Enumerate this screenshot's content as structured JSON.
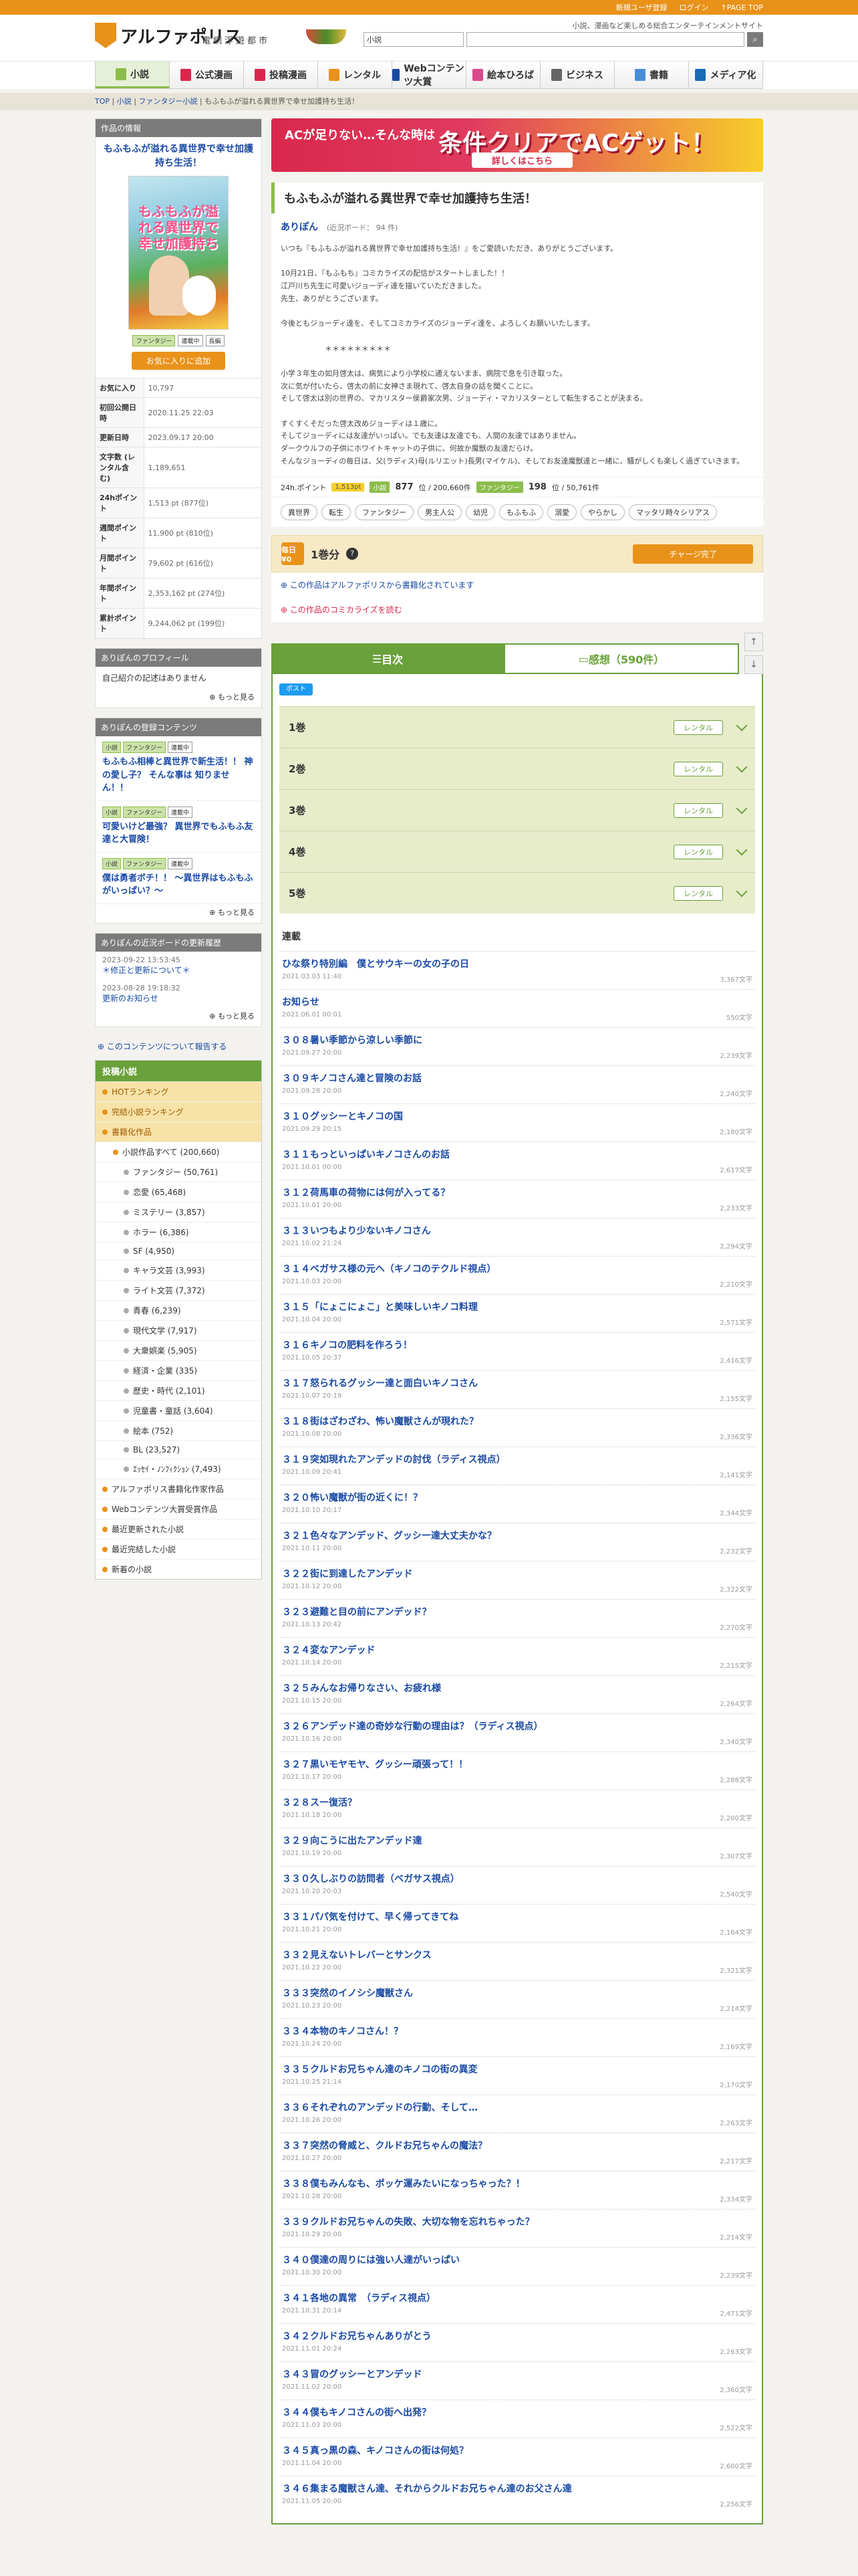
{
  "topbar": {
    "links": [
      "新規ユーザ登録",
      "ログイン",
      "↑PAGE TOP"
    ]
  },
  "header": {
    "logo_text": "アルファポリス",
    "logo_sub": "電網浮遊都市",
    "tagline": "小説、漫画など楽しめる総合エンターテインメントサイト",
    "search_select": "小説",
    "search_placeholder": ""
  },
  "nav": [
    {
      "label": "小説",
      "color": "#8bbd4c"
    },
    {
      "label": "公式漫画",
      "color": "#d9284b"
    },
    {
      "label": "投稿漫画",
      "color": "#d9284b"
    },
    {
      "label": "レンタル",
      "color": "#e9921a"
    },
    {
      "label": "Webコンテンツ大賞",
      "color": "#1a4aa5"
    },
    {
      "label": "絵本ひろば",
      "color": "#d94a8a"
    },
    {
      "label": "ビジネス",
      "color": "#666666"
    },
    {
      "label": "書籍",
      "color": "#4a8cd9"
    },
    {
      "label": "メディア化",
      "color": "#1a6ab5"
    }
  ],
  "breadcrumb": [
    "TOP",
    "小説",
    "ファンタジー小説",
    "もふもふが溢れる異世界で幸せ加護持ち生活！"
  ],
  "sidebar": {
    "info_title": "作品の情報",
    "book_title": "もふもふが溢れる異世界で幸せ加護持ち生活！",
    "cover_title": "もふもふが溢れる異世界で幸せ加護持ち",
    "mini_tags": [
      "ファンタジー",
      "連載中",
      "長編"
    ],
    "fav_btn": "お気に入りに追加",
    "stats": [
      {
        "k": "お気に入り",
        "v": "10,797"
      },
      {
        "k": "初回公開日時",
        "v": "2020.11.25 22:03"
      },
      {
        "k": "更新日時",
        "v": "2023.09.17 20:00"
      },
      {
        "k": "文字数 (レンタル含む)",
        "v": "1,189,651"
      },
      {
        "k": "24hポイント",
        "v": "1,513 pt (877位)"
      },
      {
        "k": "週間ポイント",
        "v": "11,900 pt (810位)"
      },
      {
        "k": "月間ポイント",
        "v": "79,602 pt (616位)"
      },
      {
        "k": "年間ポイント",
        "v": "2,353,162 pt (274位)"
      },
      {
        "k": "累計ポイント",
        "v": "9,244,062 pt (199位)"
      }
    ],
    "profile_title": "ありぽんのプロフィール",
    "profile_body": "自己紹介の記述はありません",
    "more": "もっと見る",
    "contents_title": "ありぽんの登録コンテンツ",
    "contents": [
      {
        "tags": [
          "小説",
          "ファンタジー",
          "連載中"
        ],
        "title": "もふもふ相棒と異世界で新生活！！ 神の愛し子？ そんな事は 知りません！！"
      },
      {
        "tags": [
          "小説",
          "ファンタジー",
          "連載中"
        ],
        "title": "可愛いけど最強？ 異世界でもふもふ友達と大冒険！"
      },
      {
        "tags": [
          "小説",
          "ファンタジー",
          "連載中"
        ],
        "title": "僕は勇者ボチ！！ 〜異世界はもふもふがいっぱい？〜"
      }
    ],
    "history_title": "ありぽんの近況ボードの更新履歴",
    "history": [
      {
        "date": "2023-09-22 13:53:45",
        "t": "＊修正と更新について＊"
      },
      {
        "date": "2023-08-28 19:18:32",
        "t": "更新のお知らせ"
      }
    ],
    "report": "このコンテンツについて報告する",
    "cat_head": "投稿小説",
    "cats": [
      {
        "label": "HOTランキング",
        "cls": "hl"
      },
      {
        "label": "完結小説ランキング",
        "cls": "hl"
      },
      {
        "label": "書籍化作品",
        "cls": "hl"
      },
      {
        "label": "小説作品すべて (200,660)",
        "cls": "sub"
      },
      {
        "label": "ファンタジー (50,761)",
        "cls": "subsub"
      },
      {
        "label": "恋愛 (65,468)",
        "cls": "subsub"
      },
      {
        "label": "ミステリー (3,857)",
        "cls": "subsub"
      },
      {
        "label": "ホラー (6,386)",
        "cls": "subsub"
      },
      {
        "label": "SF (4,950)",
        "cls": "subsub"
      },
      {
        "label": "キャラ文芸 (3,993)",
        "cls": "subsub"
      },
      {
        "label": "ライト文芸 (7,372)",
        "cls": "subsub"
      },
      {
        "label": "青春 (6,239)",
        "cls": "subsub"
      },
      {
        "label": "現代文学 (7,917)",
        "cls": "subsub"
      },
      {
        "label": "大衆娯楽 (5,905)",
        "cls": "subsub"
      },
      {
        "label": "経済・企業 (335)",
        "cls": "subsub"
      },
      {
        "label": "歴史・時代 (2,101)",
        "cls": "subsub"
      },
      {
        "label": "児童書・童話 (3,604)",
        "cls": "subsub"
      },
      {
        "label": "絵本 (752)",
        "cls": "subsub"
      },
      {
        "label": "BL (23,527)",
        "cls": "subsub"
      },
      {
        "label": "ｴｯｾｲ・ﾉﾝﾌｨｸｼｮﾝ (7,493)",
        "cls": "subsub"
      },
      {
        "label": "アルファポリス書籍化作家作品",
        "cls": ""
      },
      {
        "label": "Webコンテンツ大賞受賞作品",
        "cls": ""
      },
      {
        "label": "最近更新された小説",
        "cls": ""
      },
      {
        "label": "最近完結した小説",
        "cls": ""
      },
      {
        "label": "新着の小説",
        "cls": ""
      }
    ]
  },
  "banner": {
    "left": "ACが足りない…そんな時は",
    "big": "条件クリアでACゲット！",
    "btn": "詳しくはこちら"
  },
  "novel": {
    "title": "もふもふが溢れる異世界で幸せ加護持ち生活！",
    "author": "ありぽん",
    "board": "(近況ボード： 94 件)",
    "abstract": "いつも『もふもふが溢れる異世界で幸せ加護持ち生活！』をご愛読いただき、ありがとうございます。\n\n10月21日、『もふもち』コミカライズの配信がスタートしました！！\n江戸川ち先生に可愛いジョーディ達を描いていただきました。\n先生、ありがとうございます。\n\n今後ともジョーディ達を、そしてコミカライズのジョーディ達を、よろしくお願いいたします。\n\n　　　　　　＊＊＊＊＊＊＊＊＊\n\n小学３年生の如月啓太は、病気により小学校に通えないまま、病院で息を引き取った。\n次に気が付いたら、啓太の前に女神さま現れて、啓太自身の話を聞くことに。\nそして啓太は別の世界の、マカリスター侯爵家次男、ジョーディ・マカリスターとして転生することが決まる。\n\nすくすくそだった啓太改めジョーディは１歳に。\nそしてジョーディには友達がいっぱい。でも友達は友達でも、人間の友達ではありません。\nダークウルフの子供にホワイトキャットの子供に、何故か魔獣の友達だらけ。\nそんなジョーディの毎日は、父(ラディス)母(ルリエット)長男(マイケル)、そしてお友達魔獣達と一緒に、騒がしくも楽しく過ぎていきます。",
    "points_label": "24h.ポイント",
    "points_badge": "1,513pt",
    "rank_label1": "小説",
    "rank1": "877",
    "rank1_suffix": "位 / 200,660件",
    "rank_label2": "ファンタジー",
    "rank2": "198",
    "rank2_suffix": "位 / 50,761件",
    "tags": [
      "異世界",
      "転生",
      "ファンタジー",
      "男主人公",
      "幼児",
      "もふもふ",
      "溺愛",
      "やらかし",
      "マッタリ時々シリアス"
    ],
    "charge_icon": "毎日¥0",
    "charge_label": "1巻分",
    "charge_btn": "チャージ完了",
    "note1": "この作品はアルファポリスから書籍化されています",
    "note2": "この作品のコミカライズを読む"
  },
  "tabs": {
    "toc": "目次",
    "review": "感想（590件）"
  },
  "toc": {
    "twitter": "ポスト",
    "rental_label": "レンタル",
    "volumes": [
      "1巻",
      "2巻",
      "3巻",
      "4巻",
      "5巻"
    ],
    "section": "連載",
    "episodes": [
      {
        "t": "ひな祭り特別編　僕とサウキーの女の子の日",
        "d": "2021.03.03 11:40",
        "c": "3,367文字"
      },
      {
        "t": "お知らせ",
        "d": "2021.06.01 00:01",
        "c": "550文字"
      },
      {
        "t": "３０８暑い季節から涼しい季節に",
        "d": "2021.09.27 20:00",
        "c": "2,239文字"
      },
      {
        "t": "３０９キノコさん達と冒険のお話",
        "d": "2021.09.28 20:00",
        "c": "2,240文字"
      },
      {
        "t": "３１０グッシーとキノコの国",
        "d": "2021.09.29 20:15",
        "c": "2,180文字"
      },
      {
        "t": "３１１もっといっぱいキノコさんのお話",
        "d": "2021.10.01 00:00",
        "c": "2,617文字"
      },
      {
        "t": "３１２荷馬車の荷物には何が入ってる？",
        "d": "2021.10.01 20:00",
        "c": "2,233文字"
      },
      {
        "t": "３１３いつもより少ないキノコさん",
        "d": "2021.10.02 21:24",
        "c": "2,294文字"
      },
      {
        "t": "３１４ベガサス様の元へ（キノコのテクルド視点）",
        "d": "2021.10.03 20:00",
        "c": "2,210文字"
      },
      {
        "t": "３１５「にょこにょこ」と美味しいキノコ料理",
        "d": "2021.10.04 20:00",
        "c": "2,571文字"
      },
      {
        "t": "３１６キノコの肥料を作ろう！",
        "d": "2021.10.05 20:37",
        "c": "2,416文字"
      },
      {
        "t": "３１７怒られるグッシー達と面白いキノコさん",
        "d": "2021.10.07 20:19",
        "c": "2,155文字"
      },
      {
        "t": "３１８街はざわざわ、怖い魔獣さんが現れた？",
        "d": "2021.10.08 20:00",
        "c": "2,336文字"
      },
      {
        "t": "３１９突如現れたアンデッドの討伐（ラディス視点）",
        "d": "2021.10.09 20:41",
        "c": "2,141文字"
      },
      {
        "t": "３２０怖い魔獣が街の近くに！？",
        "d": "2021.10.10 20:17",
        "c": "2,344文字"
      },
      {
        "t": "３２１色々なアンデッド、グッシー達大丈夫かな？",
        "d": "2021.10.11 20:00",
        "c": "2,232文字"
      },
      {
        "t": "３２２街に到達したアンデッド",
        "d": "2021.10.12 20:00",
        "c": "2,322文字"
      },
      {
        "t": "３２３避難と目の前にアンデッド？",
        "d": "2021.10.13 20:42",
        "c": "2,270文字"
      },
      {
        "t": "３２４変なアンデッド",
        "d": "2021.10.14 20:00",
        "c": "2,215文字"
      },
      {
        "t": "３２５みんなお帰りなさい、お疲れ様",
        "d": "2021.10.15 20:00",
        "c": "2,264文字"
      },
      {
        "t": "３２６アンデッド達の奇妙な行動の理由は？（ラディス視点）",
        "d": "2021.10.16 20:00",
        "c": "2,340文字"
      },
      {
        "t": "３２７黒いモヤモヤ、グッシー頑張って！！",
        "d": "2021.10.17 20:00",
        "c": "2,288文字"
      },
      {
        "t": "３２８スー復活？",
        "d": "2021.10.18 20:00",
        "c": "2,200文字"
      },
      {
        "t": "３２９向こうに出たアンデッド達",
        "d": "2021.10.19 20:00",
        "c": "2,307文字"
      },
      {
        "t": "３３０久しぶりの訪問者（ベガサス視点）",
        "d": "2021.10.20 20:03",
        "c": "2,540文字"
      },
      {
        "t": "３３１パパ気を付けて、早く帰ってきてね",
        "d": "2021.10.21 20:00",
        "c": "2,164文字"
      },
      {
        "t": "３３２見えないトレバーとサンクス",
        "d": "2021.10.22 20:00",
        "c": "2,321文字"
      },
      {
        "t": "３３３突然のイノシシ魔獣さん",
        "d": "2021.10.23 20:00",
        "c": "2,214文字"
      },
      {
        "t": "３３４本物のキノコさん！？",
        "d": "2021.10.24 20:00",
        "c": "2,169文字"
      },
      {
        "t": "３３５クルドお兄ちゃん達のキノコの街の異変",
        "d": "2021.10.25 21:14",
        "c": "2,170文字"
      },
      {
        "t": "３３６それぞれのアンデッドの行動、そして…",
        "d": "2021.10.26 20:00",
        "c": "2,263文字"
      },
      {
        "t": "３３７突然の脅威と、クルドお兄ちゃんの魔法？",
        "d": "2021.10.27 20:00",
        "c": "2,217文字"
      },
      {
        "t": "３３８僕もみんなも、ポッケ運みたいになっちゃった？！",
        "d": "2021.10.28 20:00",
        "c": "2,334文字"
      },
      {
        "t": "３３９クルドお兄ちゃんの失敗、大切な物を忘れちゃった？",
        "d": "2021.10.29 20:00",
        "c": "2,214文字"
      },
      {
        "t": "３４０僕達の周りには強い人達がいっぱい",
        "d": "2021.10.30 20:00",
        "c": "2,239文字"
      },
      {
        "t": "３４１各地の異常　（ラディス視点）",
        "d": "2021.10.31 20:14",
        "c": "2,471文字"
      },
      {
        "t": "３４２クルドお兄ちゃんありがとう",
        "d": "2021.11.01 20:24",
        "c": "2,263文字"
      },
      {
        "t": "３４３冒のグッシーとアンデッド",
        "d": "2021.11.02 20:00",
        "c": "2,360文字"
      },
      {
        "t": "３４４僕もキノコさんの街へ出発？",
        "d": "2021.11.03 20:00",
        "c": "2,522文字"
      },
      {
        "t": "３４５真っ黒の森、キノコさんの街は何処？",
        "d": "2021.11.04 20:00",
        "c": "2,600文字"
      },
      {
        "t": "３４６集まる魔獣さん達、それからクルドお兄ちゃん達のお父さん達",
        "d": "2021.11.05 20:00",
        "c": "2,256文字"
      }
    ]
  }
}
